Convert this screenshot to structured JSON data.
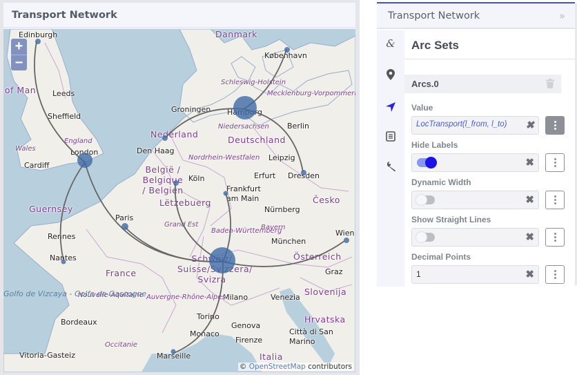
{
  "map_card": {
    "title": "Transport Network",
    "zoom_in": "+",
    "zoom_out": "−",
    "attribution_prefix": "©",
    "attribution_link": "OpenStreetMap",
    "attribution_suffix": " contributors",
    "labels": {
      "cities": [
        "Edinburgh",
        "Leeds",
        "Sheffield",
        "London",
        "Cardiff",
        "Rennes",
        "Nantes",
        "Bordeaux",
        "Vitoria-Gasteiz",
        "Paris",
        "Den Haag",
        "Groningen",
        "Hamburg",
        "København",
        "Berlin",
        "Leipzig",
        "Dresden",
        "Erfurt",
        "Köln",
        "Frankfurt am Main",
        "Nürnberg",
        "München",
        "Wien",
        "Graz",
        "Milano",
        "Venezia",
        "Torino",
        "Genova",
        "Monaco",
        "Firenze",
        "Città di San Marino",
        "Marseille"
      ],
      "countries": [
        "Danmark",
        "Nederland",
        "Deutschland",
        "België / Belgique / Belgien",
        "Lëtzebuerg",
        "France",
        "Schweiz/ Suisse/Svizzera/ Svizra",
        "Česko",
        "Österreich",
        "Slovenija",
        "Hrvatska",
        "Italia",
        "Guernsey",
        "Isle of Man"
      ],
      "regions": [
        "Schleswig-Holstein",
        "Mecklenburg-Vorpommern",
        "Niedersachsen",
        "Nordrhein-Westfalen",
        "Baden-Württemberg",
        "Bayern",
        "Grand Est",
        "England",
        "Wales",
        "Nouvelle-Aquitaine",
        "Auvergne-Rhône-Alpes",
        "Occitanie"
      ],
      "seas": [
        "Golfo de Vizcaya - Golfe de Gascogne"
      ]
    },
    "arcs": [
      {
        "from": "London",
        "to": "Edinburgh"
      },
      {
        "from": "London",
        "to": "Nantes"
      },
      {
        "from": "London",
        "to": "Schweiz"
      },
      {
        "from": "Nederland",
        "to": "Hamburg"
      },
      {
        "from": "Hamburg",
        "to": "København"
      },
      {
        "from": "Hamburg",
        "to": "Dresden"
      },
      {
        "from": "Schweiz",
        "to": "Belgien"
      },
      {
        "from": "Schweiz",
        "to": "Frankfurt am Main"
      },
      {
        "from": "Paris",
        "to": "Schweiz"
      },
      {
        "from": "Schweiz",
        "to": "Wien"
      },
      {
        "from": "Schweiz",
        "to": "Marseille"
      }
    ]
  },
  "panel": {
    "header_title": "Transport Network",
    "collapse_icon": "double-chevron-right-icon",
    "rail_icons": [
      "ampersand-icon",
      "map-pin-icon",
      "navigation-arrow-icon",
      "list-document-icon",
      "wrench-icon"
    ],
    "section_title": "Arc Sets",
    "arc_set_name": "Arcs.0",
    "fields": {
      "value": {
        "label": "Value",
        "text": "LocTransport(l_from, l_to)"
      },
      "hide_labels": {
        "label": "Hide Labels",
        "checked": true
      },
      "dynamic_width": {
        "label": "Dynamic Width",
        "checked": false
      },
      "show_straight_lines": {
        "label": "Show Straight Lines",
        "checked": false
      },
      "decimal_points": {
        "label": "Decimal Points",
        "text": "1"
      }
    },
    "clear_glyph": "✖",
    "accent_color": "#3f4fe0"
  }
}
